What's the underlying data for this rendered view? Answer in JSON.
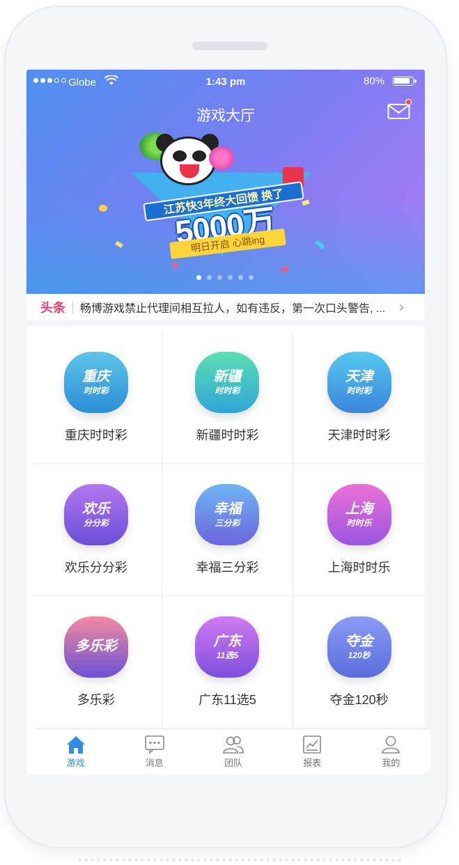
{
  "status_bar": {
    "carrier": "Globe",
    "time": "1:43 pm",
    "battery": "80%"
  },
  "header": {
    "title": "游戏大厅"
  },
  "banner": {
    "ribbon_text": "江苏快3年终大回馈 换了",
    "headline": "5000万",
    "subline": "明日开启 心跳ing",
    "page_count": 6,
    "active_page": 0
  },
  "ticker": {
    "tag": "头条",
    "text": "畅博游戏禁止代理间相互拉人，如有违反，第一次口头警告, ..."
  },
  "games": [
    {
      "name": "重庆时时彩",
      "icon_l1": "重庆",
      "icon_l2": "时时彩",
      "color_a": "#5ec4e8",
      "color_b": "#2a8fd6"
    },
    {
      "name": "新疆时时彩",
      "icon_l1": "新疆",
      "icon_l2": "时时彩",
      "color_a": "#5ce0b2",
      "color_b": "#2fa4d8"
    },
    {
      "name": "天津时时彩",
      "icon_l1": "天津",
      "icon_l2": "时时彩",
      "color_a": "#56c8f0",
      "color_b": "#3a86dc"
    },
    {
      "name": "欢乐分分彩",
      "icon_l1": "欢乐",
      "icon_l2": "分分彩",
      "color_a": "#b476f0",
      "color_b": "#6b4fd8"
    },
    {
      "name": "幸福三分彩",
      "icon_l1": "幸福",
      "icon_l2": "三分彩",
      "color_a": "#6fb4f4",
      "color_b": "#6a66dc"
    },
    {
      "name": "上海时时乐",
      "icon_l1": "上海",
      "icon_l2": "时时乐",
      "color_a": "#ec6fd8",
      "color_b": "#9a56e0"
    },
    {
      "name": "多乐彩",
      "icon_l1": "多乐彩",
      "icon_l2": "",
      "color_a": "#f48aa0",
      "color_b": "#6a52d6"
    },
    {
      "name": "广东11选5",
      "icon_l1": "广东",
      "icon_l2": "11选5",
      "color_a": "#d27af0",
      "color_b": "#7d4fde"
    },
    {
      "name": "夺金120秒",
      "icon_l1": "夺金",
      "icon_l2": "120秒",
      "color_a": "#8a9cf4",
      "color_b": "#5a6ddc"
    }
  ],
  "tabs": [
    {
      "label": "游戏",
      "icon": "home-icon",
      "active": true
    },
    {
      "label": "消息",
      "icon": "message-icon",
      "active": false
    },
    {
      "label": "团队",
      "icon": "team-icon",
      "active": false
    },
    {
      "label": "报表",
      "icon": "report-icon",
      "active": false
    },
    {
      "label": "我的",
      "icon": "user-icon",
      "active": false
    }
  ],
  "colors": {
    "accent": "#2f8de4",
    "ticker_tag": "#ef3d70",
    "notification_dot": "#ff4b4b"
  }
}
